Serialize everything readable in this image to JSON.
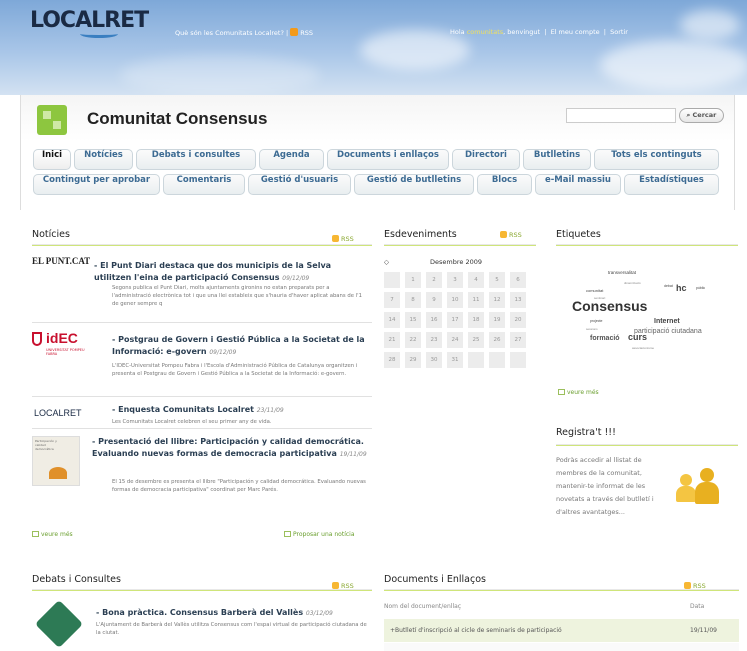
{
  "header": {
    "logo": "LOCALRET",
    "tagline_link": "Què són les Comunitats Localret?",
    "rss_label": "RSS",
    "greeting_prefix": "Hola",
    "username": "comunitats",
    "greeting_suffix": ", benvingut",
    "my_account": "El meu compte",
    "logout": "Sortir"
  },
  "community": {
    "title": "Comunitat Consensus",
    "search_button": "Cercar"
  },
  "tabs_row1": [
    "Inici",
    "Notícies",
    "Debats i consultes",
    "Agenda",
    "Documents i enllaços",
    "Directori",
    "Butlletins",
    "Tots els continguts"
  ],
  "tabs_row2": [
    "Contingut per aprobar",
    "Comentaris",
    "Gestió d'usuaris",
    "Gestió de butlletins",
    "Blocs",
    "e-Mail massiu",
    "Estadístiques"
  ],
  "news": {
    "title": "Notícies",
    "rss": "RSS",
    "items": [
      {
        "logo": "EL PUNT.CAT",
        "title": "- El Punt Diari destaca que dos municipis de la Selva utilitzen l'eina de participació Consensus",
        "date": "09/12/09",
        "summary": "Segons publica el Punt Diari, molts ajuntaments gironins no estan preparats per a l'administració electrònica tot i que una llei estableix que s'hauria d'haver aplicat abans de l'1 de gener sempre q"
      },
      {
        "logo": "idEC",
        "logo_sub": "UNIVERSITAT POMPEU FABRA",
        "title": "- Postgrau de Govern i Gestió Pública a la Societat de la Informació: e-govern",
        "date": "09/12/09",
        "summary": "L'IDEC-Universitat Pompeu Fabra i l'Escola d'Administració Pública de Catalunya organitzen i presenta el Postgrau de Govern i Gestió Pública a la Societat de la Informació: e-govern."
      },
      {
        "logo": "LOCALRET",
        "title": "- Enquesta Comunitats Localret",
        "date": "23/11/09",
        "summary": "Les Comunitats Localret celebren el seu primer any de vida."
      },
      {
        "logo": "Participación y calidad democrática",
        "title": "- Presentació del llibre: Participación y calidad democrática. Evaluando nuevas formas de democracia participativa",
        "date": "19/11/09",
        "summary": "El 15 de desembre es presenta el llibre \"Participación y calidad democrática. Evaluando nuevas formas de democracia participativa\" coordinat per Marc Parés."
      }
    ],
    "see_more": "veure més",
    "propose": "Proposar una notícia"
  },
  "events": {
    "title": "Esdeveniments",
    "rss": "RSS",
    "month": "Desembre 2009",
    "days": [
      "",
      "1",
      "2",
      "3",
      "4",
      "5",
      "6",
      "7",
      "8",
      "9",
      "10",
      "11",
      "12",
      "13",
      "14",
      "15",
      "16",
      "17",
      "18",
      "19",
      "20",
      "21",
      "22",
      "23",
      "24",
      "25",
      "26",
      "27",
      "28",
      "29",
      "30",
      "31",
      "",
      "",
      ""
    ]
  },
  "tags": {
    "title": "Etiquetes",
    "cloud": [
      "transversalitat",
      "comunitat",
      "dinamització",
      "sentinari",
      "debat",
      "hc",
      "públic",
      "Consensus",
      "Internet",
      "projecte",
      "participació ciutadana",
      "formació",
      "curs",
      "sessions",
      "associacionisme"
    ],
    "see_more": "veure més"
  },
  "register": {
    "title": "Registra't !!!",
    "text": "Podràs accedir al llistat de membres de la comunitat, mantenir-te informat de les novetats a través del butlletí i d'altres avantatges..."
  },
  "debates": {
    "title": "Debats i Consultes",
    "rss": "RSS",
    "items": [
      {
        "title": "- Bona pràctica. Consensus Barberà del Vallès",
        "date": "03/12/09",
        "summary": "L'Ajuntament de Barberà del Vallès utilitza Consensus com l'espai virtual de participació ciutadana de la ciutat."
      }
    ]
  },
  "documents": {
    "title": "Documents i Enllaços",
    "rss": "RSS",
    "col_name": "Nom del document/enllaç",
    "col_date": "Data",
    "rows": [
      {
        "name": "+Butlletí d'inscripció al cicle de seminaris de participació",
        "date": "19/11/09"
      }
    ]
  },
  "colors": {
    "accent_green": "#8dc63f",
    "tab_text": "#3d6b93",
    "rss": "#f39a1a"
  }
}
